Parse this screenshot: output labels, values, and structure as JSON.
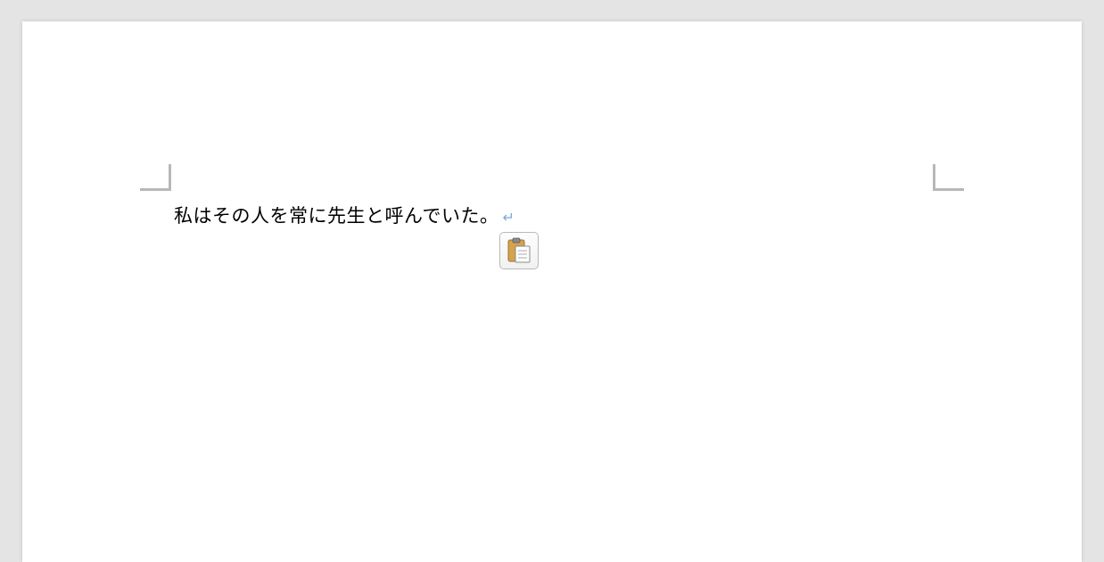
{
  "document": {
    "body_text": "私はその人を常に先生と呼んでいた。",
    "paragraph_mark": "↵"
  },
  "smarttag": {
    "name": "paste-options"
  }
}
